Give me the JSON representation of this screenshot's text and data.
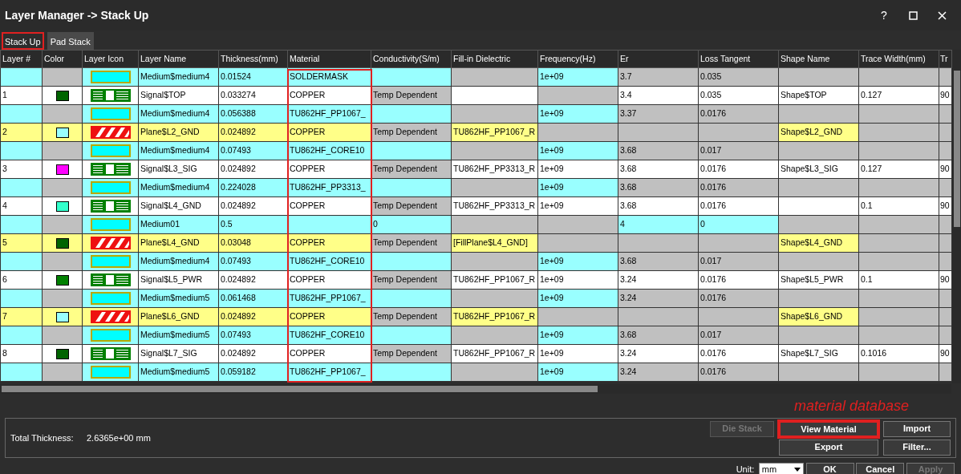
{
  "window": {
    "title": "Layer Manager -> Stack Up",
    "help": "?"
  },
  "tabs": [
    {
      "label": "Stack Up",
      "selected": true,
      "highlighted": true
    },
    {
      "label": "Pad Stack",
      "selected": false,
      "highlighted": false
    }
  ],
  "table": {
    "columns": [
      {
        "label": "Layer #"
      },
      {
        "label": "Color"
      },
      {
        "label": "Layer Icon"
      },
      {
        "label": "Layer Name"
      },
      {
        "label": "Thickness(mm)"
      },
      {
        "label": "Material",
        "highlighted": true
      },
      {
        "label": "Conductivity(S/m)"
      },
      {
        "label": "Fill-in Dielectric"
      },
      {
        "label": "Frequency(Hz)"
      },
      {
        "label": "Er"
      },
      {
        "label": "Loss Tangent"
      },
      {
        "label": "Shape Name"
      },
      {
        "label": "Trace Width(mm)"
      },
      {
        "label": "Tr"
      }
    ],
    "rows": [
      {
        "kind": "medium",
        "cells": [
          {
            "disabled": false
          },
          {
            "disabled": true
          },
          {
            "disabled": false
          },
          {
            "text": "Medium$medium4",
            "disabled": false
          },
          {
            "text": "0.01524",
            "disabled": false
          },
          {
            "text": "SOLDERMASK",
            "disabled": false
          },
          {
            "disabled": false
          },
          {
            "disabled": true
          },
          {
            "text": "1e+09",
            "disabled": false
          },
          {
            "text": "3.7",
            "disabled": true
          },
          {
            "text": "0.035",
            "disabled": true
          },
          {
            "disabled": true
          },
          {
            "disabled": true
          },
          {
            "disabled": true
          }
        ]
      },
      {
        "kind": "signal",
        "cells": [
          {
            "text": "1",
            "disabled": false
          },
          {
            "color": "#006400",
            "disabled": false
          },
          {
            "disabled": false
          },
          {
            "text": "Signal$TOP",
            "disabled": false
          },
          {
            "text": "0.033274",
            "disabled": false
          },
          {
            "text": "COPPER",
            "disabled": false
          },
          {
            "text": "Temp Dependent",
            "disabled": true
          },
          {
            "disabled": false
          },
          {
            "disabled": true
          },
          {
            "text": "3.4",
            "disabled": false
          },
          {
            "text": "0.035",
            "disabled": false
          },
          {
            "text": "Shape$TOP",
            "disabled": false
          },
          {
            "text": "0.127",
            "disabled": false
          },
          {
            "text": "90",
            "disabled": false
          }
        ]
      },
      {
        "kind": "medium",
        "cells": [
          {
            "disabled": false
          },
          {
            "disabled": true
          },
          {
            "disabled": false
          },
          {
            "text": "Medium$medium4",
            "disabled": false
          },
          {
            "text": "0.056388",
            "disabled": false
          },
          {
            "text": "TU862HF_PP1067_",
            "disabled": false
          },
          {
            "disabled": false
          },
          {
            "disabled": true
          },
          {
            "text": "1e+09",
            "disabled": false
          },
          {
            "text": "3.37",
            "disabled": true
          },
          {
            "text": "0.0176",
            "disabled": true
          },
          {
            "disabled": true
          },
          {
            "disabled": true
          },
          {
            "disabled": true
          }
        ]
      },
      {
        "kind": "plane",
        "cells": [
          {
            "text": "2",
            "disabled": false
          },
          {
            "color": "#99ffff",
            "disabled": false
          },
          {
            "disabled": false
          },
          {
            "text": "Plane$L2_GND",
            "disabled": false
          },
          {
            "text": "0.024892",
            "disabled": false
          },
          {
            "text": "COPPER",
            "disabled": false
          },
          {
            "text": "Temp Dependent",
            "disabled": true
          },
          {
            "text": "TU862HF_PP1067_R",
            "disabled": false
          },
          {
            "disabled": true
          },
          {
            "disabled": true
          },
          {
            "disabled": true
          },
          {
            "text": "Shape$L2_GND",
            "disabled": false
          },
          {
            "disabled": true
          },
          {
            "disabled": true
          }
        ]
      },
      {
        "kind": "medium",
        "cells": [
          {
            "disabled": false
          },
          {
            "disabled": true
          },
          {
            "disabled": false
          },
          {
            "text": "Medium$medium4",
            "disabled": false
          },
          {
            "text": "0.07493",
            "disabled": false
          },
          {
            "text": "TU862HF_CORE10",
            "disabled": false
          },
          {
            "disabled": false
          },
          {
            "disabled": true
          },
          {
            "text": "1e+09",
            "disabled": false
          },
          {
            "text": "3.68",
            "disabled": true
          },
          {
            "text": "0.017",
            "disabled": true
          },
          {
            "disabled": true
          },
          {
            "disabled": true
          },
          {
            "disabled": true
          }
        ]
      },
      {
        "kind": "signal",
        "cells": [
          {
            "text": "3",
            "disabled": false
          },
          {
            "color": "#ff00ff",
            "disabled": false
          },
          {
            "disabled": false
          },
          {
            "text": "Signal$L3_SIG",
            "disabled": false
          },
          {
            "text": "0.024892",
            "disabled": false
          },
          {
            "text": "COPPER",
            "disabled": false
          },
          {
            "text": "Temp Dependent",
            "disabled": true
          },
          {
            "text": "TU862HF_PP3313_R",
            "disabled": false
          },
          {
            "text": "1e+09",
            "disabled": false
          },
          {
            "text": "3.68",
            "disabled": false
          },
          {
            "text": "0.0176",
            "disabled": false
          },
          {
            "text": "Shape$L3_SIG",
            "disabled": false
          },
          {
            "text": "0.127",
            "disabled": false
          },
          {
            "text": "90",
            "disabled": false
          }
        ]
      },
      {
        "kind": "medium",
        "cells": [
          {
            "disabled": false
          },
          {
            "disabled": true
          },
          {
            "disabled": false
          },
          {
            "text": "Medium$medium4",
            "disabled": false
          },
          {
            "text": "0.224028",
            "disabled": false
          },
          {
            "text": "TU862HF_PP3313_",
            "disabled": false
          },
          {
            "disabled": false
          },
          {
            "disabled": true
          },
          {
            "text": "1e+09",
            "disabled": false
          },
          {
            "text": "3.68",
            "disabled": true
          },
          {
            "text": "0.0176",
            "disabled": true
          },
          {
            "disabled": true
          },
          {
            "disabled": true
          },
          {
            "disabled": true
          }
        ]
      },
      {
        "kind": "signal",
        "cells": [
          {
            "text": "4",
            "disabled": false
          },
          {
            "color": "#33ffcc",
            "disabled": false
          },
          {
            "disabled": false
          },
          {
            "text": "Signal$L4_GND",
            "disabled": false
          },
          {
            "text": "0.024892",
            "disabled": false
          },
          {
            "text": "COPPER",
            "disabled": false
          },
          {
            "text": "Temp Dependent",
            "disabled": true
          },
          {
            "text": "TU862HF_PP3313_R",
            "disabled": false
          },
          {
            "text": "1e+09",
            "disabled": false
          },
          {
            "text": "3.68",
            "disabled": false
          },
          {
            "text": "0.0176",
            "disabled": false
          },
          {
            "disabled": false
          },
          {
            "text": "0.1",
            "disabled": false
          },
          {
            "text": "90",
            "disabled": false
          }
        ]
      },
      {
        "kind": "medium",
        "cells": [
          {
            "disabled": false
          },
          {
            "disabled": true
          },
          {
            "disabled": false
          },
          {
            "text": "Medium01",
            "disabled": false
          },
          {
            "text": "0.5",
            "disabled": false
          },
          {
            "disabled": false
          },
          {
            "text": "0",
            "disabled": false
          },
          {
            "disabled": true
          },
          {
            "disabled": true
          },
          {
            "text": "4",
            "disabled": false
          },
          {
            "text": "0",
            "disabled": false
          },
          {
            "disabled": true
          },
          {
            "disabled": true
          },
          {
            "disabled": true
          }
        ]
      },
      {
        "kind": "plane",
        "cells": [
          {
            "text": "5",
            "disabled": false
          },
          {
            "color": "#006400",
            "disabled": false
          },
          {
            "disabled": false
          },
          {
            "text": "Plane$L4_GND",
            "disabled": false
          },
          {
            "text": "0.03048",
            "disabled": false
          },
          {
            "text": "COPPER",
            "disabled": false
          },
          {
            "text": "Temp Dependent",
            "disabled": true
          },
          {
            "text": "[FillPlane$L4_GND]",
            "disabled": false
          },
          {
            "disabled": true
          },
          {
            "disabled": true
          },
          {
            "disabled": true
          },
          {
            "text": "Shape$L4_GND",
            "disabled": false
          },
          {
            "disabled": true
          },
          {
            "disabled": true
          }
        ]
      },
      {
        "kind": "medium",
        "cells": [
          {
            "disabled": false
          },
          {
            "disabled": true
          },
          {
            "disabled": false
          },
          {
            "text": "Medium$medium4",
            "disabled": false
          },
          {
            "text": "0.07493",
            "disabled": false
          },
          {
            "text": "TU862HF_CORE10",
            "disabled": false
          },
          {
            "disabled": false
          },
          {
            "disabled": true
          },
          {
            "text": "1e+09",
            "disabled": false
          },
          {
            "text": "3.68",
            "disabled": true
          },
          {
            "text": "0.017",
            "disabled": true
          },
          {
            "disabled": true
          },
          {
            "disabled": true
          },
          {
            "disabled": true
          }
        ]
      },
      {
        "kind": "signal",
        "cells": [
          {
            "text": "6",
            "disabled": false
          },
          {
            "color": "#008000",
            "disabled": false
          },
          {
            "disabled": false
          },
          {
            "text": "Signal$L5_PWR",
            "disabled": false
          },
          {
            "text": "0.024892",
            "disabled": false
          },
          {
            "text": "COPPER",
            "disabled": false
          },
          {
            "text": "Temp Dependent",
            "disabled": true
          },
          {
            "text": "TU862HF_PP1067_R",
            "disabled": false
          },
          {
            "text": "1e+09",
            "disabled": false
          },
          {
            "text": "3.24",
            "disabled": false
          },
          {
            "text": "0.0176",
            "disabled": false
          },
          {
            "text": "Shape$L5_PWR",
            "disabled": false
          },
          {
            "text": "0.1",
            "disabled": false
          },
          {
            "text": "90",
            "disabled": false
          }
        ]
      },
      {
        "kind": "medium",
        "cells": [
          {
            "disabled": false
          },
          {
            "disabled": true
          },
          {
            "disabled": false
          },
          {
            "text": "Medium$medium5",
            "disabled": false
          },
          {
            "text": "0.061468",
            "disabled": false
          },
          {
            "text": "TU862HF_PP1067_",
            "disabled": false
          },
          {
            "disabled": false
          },
          {
            "disabled": true
          },
          {
            "text": "1e+09",
            "disabled": false
          },
          {
            "text": "3.24",
            "disabled": true
          },
          {
            "text": "0.0176",
            "disabled": true
          },
          {
            "disabled": true
          },
          {
            "disabled": true
          },
          {
            "disabled": true
          }
        ]
      },
      {
        "kind": "plane",
        "cells": [
          {
            "text": "7",
            "disabled": false
          },
          {
            "color": "#99ffff",
            "disabled": false
          },
          {
            "disabled": false
          },
          {
            "text": "Plane$L6_GND",
            "disabled": false
          },
          {
            "text": "0.024892",
            "disabled": false
          },
          {
            "text": "COPPER",
            "disabled": false
          },
          {
            "text": "Temp Dependent",
            "disabled": true
          },
          {
            "text": "TU862HF_PP1067_R",
            "disabled": false
          },
          {
            "disabled": true
          },
          {
            "disabled": true
          },
          {
            "disabled": true
          },
          {
            "text": "Shape$L6_GND",
            "disabled": false
          },
          {
            "disabled": true
          },
          {
            "disabled": true
          }
        ]
      },
      {
        "kind": "medium",
        "cells": [
          {
            "disabled": false
          },
          {
            "disabled": true
          },
          {
            "disabled": false
          },
          {
            "text": "Medium$medium5",
            "disabled": false
          },
          {
            "text": "0.07493",
            "disabled": false
          },
          {
            "text": "TU862HF_CORE10",
            "disabled": false
          },
          {
            "disabled": false
          },
          {
            "disabled": true
          },
          {
            "text": "1e+09",
            "disabled": false
          },
          {
            "text": "3.68",
            "disabled": true
          },
          {
            "text": "0.017",
            "disabled": true
          },
          {
            "disabled": true
          },
          {
            "disabled": true
          },
          {
            "disabled": true
          }
        ]
      },
      {
        "kind": "signal",
        "cells": [
          {
            "text": "8",
            "disabled": false
          },
          {
            "color": "#006400",
            "disabled": false
          },
          {
            "disabled": false
          },
          {
            "text": "Signal$L7_SIG",
            "disabled": false
          },
          {
            "text": "0.024892",
            "disabled": false
          },
          {
            "text": "COPPER",
            "disabled": false
          },
          {
            "text": "Temp Dependent",
            "disabled": true
          },
          {
            "text": "TU862HF_PP1067_R",
            "disabled": false
          },
          {
            "text": "1e+09",
            "disabled": false
          },
          {
            "text": "3.24",
            "disabled": false
          },
          {
            "text": "0.0176",
            "disabled": false
          },
          {
            "text": "Shape$L7_SIG",
            "disabled": false
          },
          {
            "text": "0.1016",
            "disabled": false
          },
          {
            "text": "90",
            "disabled": false
          }
        ]
      },
      {
        "kind": "medium",
        "cells": [
          {
            "disabled": false
          },
          {
            "disabled": true
          },
          {
            "disabled": false
          },
          {
            "text": "Medium$medium5",
            "disabled": false
          },
          {
            "text": "0.059182",
            "disabled": false
          },
          {
            "text": "TU862HF_PP1067_",
            "disabled": false
          },
          {
            "disabled": false
          },
          {
            "disabled": true
          },
          {
            "text": "1e+09",
            "disabled": false
          },
          {
            "text": "3.24",
            "disabled": true
          },
          {
            "text": "0.0176",
            "disabled": true
          },
          {
            "disabled": true
          },
          {
            "disabled": true
          },
          {
            "disabled": true
          }
        ]
      }
    ]
  },
  "annotation": "material database",
  "summary": {
    "label": "Total Thickness:",
    "value": "2.6365e+00 mm"
  },
  "buttons": [
    {
      "label": "Die Stack",
      "disabled": true,
      "highlighted": false
    },
    {
      "label": "View Material",
      "disabled": false,
      "highlighted": true
    },
    {
      "label": "Import",
      "disabled": false,
      "highlighted": false
    },
    {
      "label": "Export",
      "disabled": false,
      "highlighted": false
    },
    {
      "label": "Filter...",
      "disabled": false,
      "highlighted": false
    }
  ],
  "unit": {
    "label": "Unit:",
    "value": "mm"
  },
  "dialog_buttons": [
    {
      "label": "OK",
      "disabled": false
    },
    {
      "label": "Cancel",
      "disabled": false
    },
    {
      "label": "Apply",
      "disabled": true
    }
  ]
}
